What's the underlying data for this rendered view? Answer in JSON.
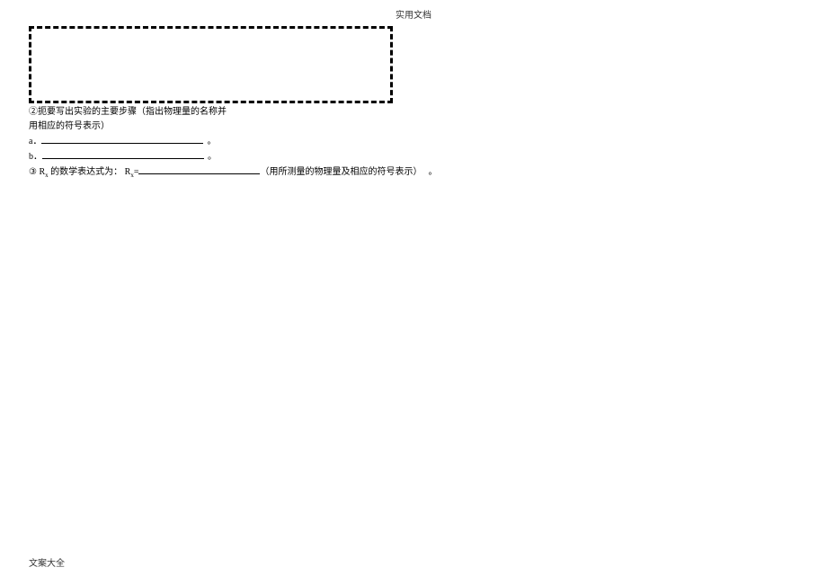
{
  "header": {
    "title": "实用文档"
  },
  "content": {
    "line2_intro": "②扼要写出实验的主要步骤（指出物理量的名称并",
    "line2_cont": "用相应的符号表示）",
    "item_a_label": "a．",
    "item_a_period": "。",
    "item_b_label": "b．",
    "item_b_period": "。",
    "line3_prefix": "③ R",
    "line3_sub": "x",
    "line3_mid1": " 的数学表达式为： R",
    "line3_sub2": "x",
    "line3_mid2": "=",
    "line3_suffix": "（用所测量的物理量及相应的符号表示）",
    "line3_period": "。"
  },
  "footer": {
    "text": "文案大全"
  }
}
